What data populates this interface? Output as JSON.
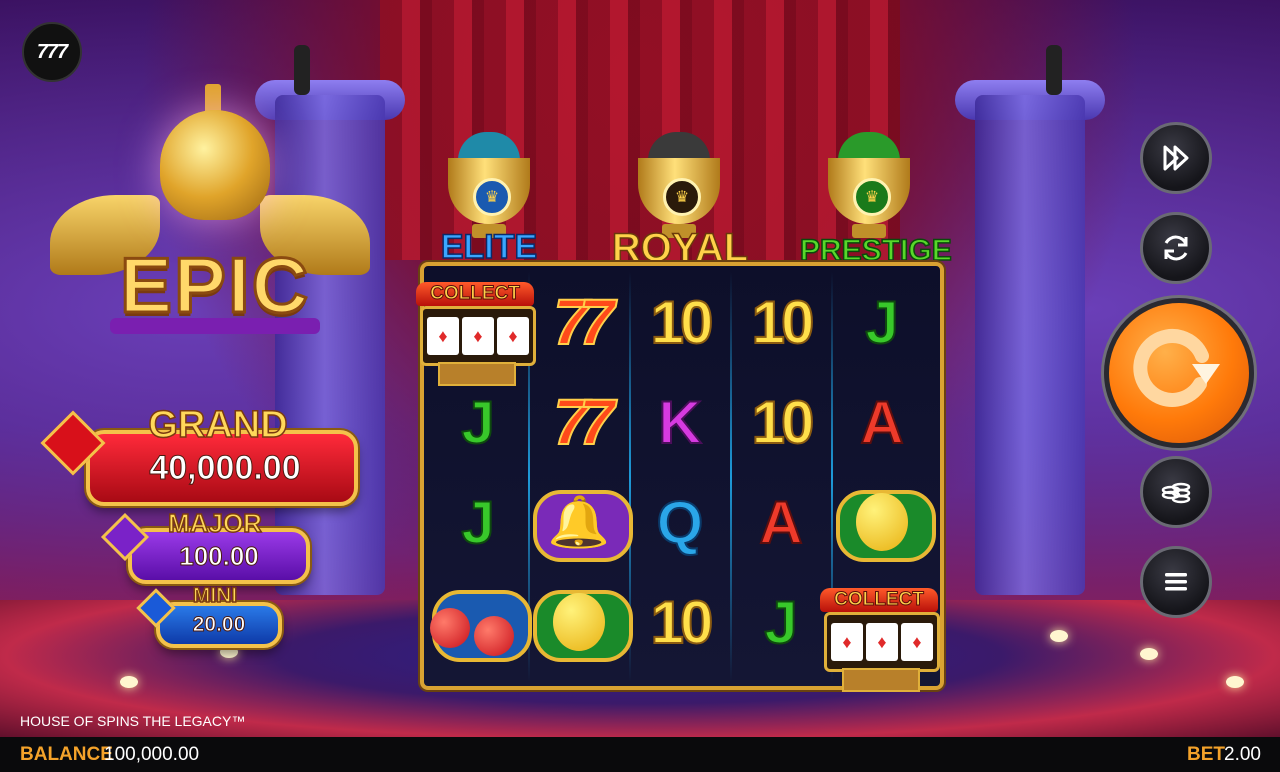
{
  "game": {
    "title": "HOUSE OF SPINS THE LEGACY™",
    "logo_text": "777"
  },
  "epic": {
    "label": "EPIC"
  },
  "jackpots": [
    {
      "name": "GRAND",
      "value": "40,000.00",
      "color": "#d8101a"
    },
    {
      "name": "MAJOR",
      "value": "100.00",
      "color": "#7a22c8"
    },
    {
      "name": "MINI",
      "value": "20.00",
      "color": "#1a5ad8"
    }
  ],
  "trophies": [
    {
      "name": "ELITE",
      "emblem": "crown-blue",
      "chips_color": "#1f8aa8",
      "label_color": "#3aa6ff"
    },
    {
      "name": "ROYAL",
      "emblem": "crown-gold",
      "chips_color": "#3a3a3a",
      "label_color": "#ffd24a"
    },
    {
      "name": "PRESTIGE",
      "emblem": "crown-green",
      "chips_color": "#2a9a2a",
      "label_color": "#58d82a"
    }
  ],
  "reels": {
    "columns": [
      [
        "collect",
        "J",
        "J",
        "cherry"
      ],
      [
        "7",
        "7",
        "bell",
        "lemon"
      ],
      [
        "10",
        "K",
        "Q",
        "10"
      ],
      [
        "10",
        "10",
        "A",
        "J"
      ],
      [
        "J",
        "A",
        "lemon",
        "collect"
      ]
    ],
    "collect_label": "COLLECT"
  },
  "controls": {
    "turbo_icon": "fast-forward-icon",
    "autoplay_icon": "autoplay-icon",
    "spin_icon": "spin-arrow-icon",
    "bet_icon": "coins-icon",
    "menu_icon": "menu-icon"
  },
  "footer": {
    "balance_label": "BALANCE",
    "balance_value": "100,000.00",
    "bet_label": "BET",
    "bet_value": "2.00",
    "label_color": "#f4a22a"
  }
}
